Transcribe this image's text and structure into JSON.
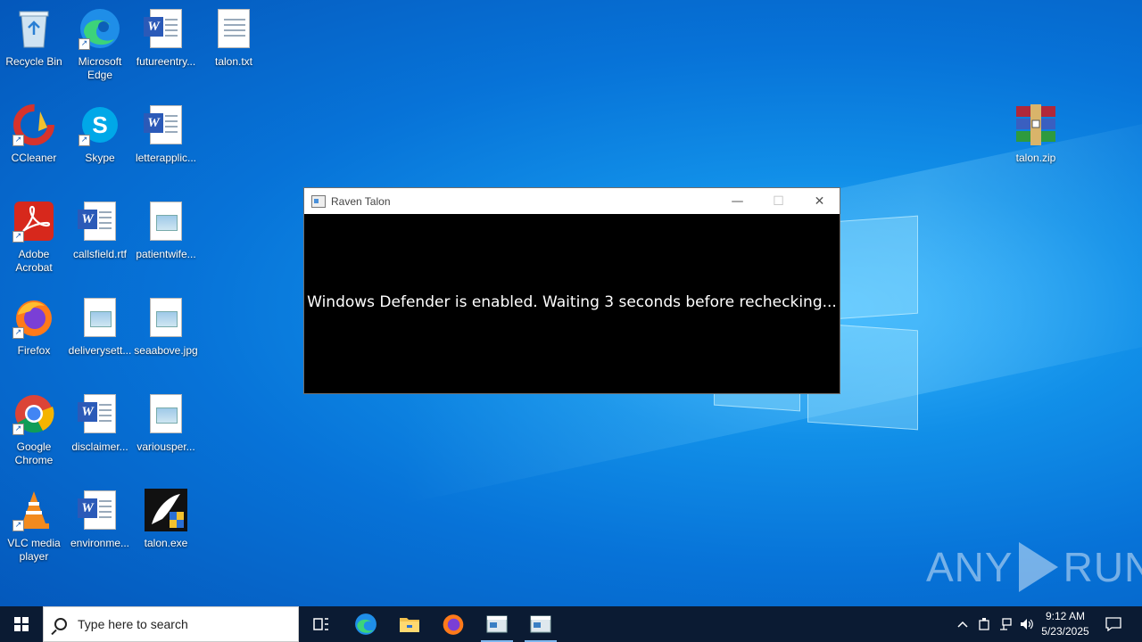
{
  "desktop": {
    "icons": [
      {
        "label": "Recycle Bin"
      },
      {
        "label": "Microsoft Edge"
      },
      {
        "label": "futureentry..."
      },
      {
        "label": "talon.txt"
      },
      {
        "label": "CCleaner"
      },
      {
        "label": "Skype"
      },
      {
        "label": "letterapplic..."
      },
      {
        "label": "Adobe Acrobat"
      },
      {
        "label": "callsfield.rtf"
      },
      {
        "label": "patientwife..."
      },
      {
        "label": "Firefox"
      },
      {
        "label": "deliverysett..."
      },
      {
        "label": "seaabove.jpg"
      },
      {
        "label": "Google Chrome"
      },
      {
        "label": "disclaimer..."
      },
      {
        "label": "variousper..."
      },
      {
        "label": "VLC media player"
      },
      {
        "label": "environme..."
      },
      {
        "label": "talon.exe"
      },
      {
        "label": "talon.zip"
      }
    ]
  },
  "window": {
    "title": "Raven Talon",
    "minimize_glyph": "—",
    "maximize_glyph": "☐",
    "close_glyph": "✕",
    "console_text": "Windows Defender is enabled. Waiting 3 seconds before rechecking..."
  },
  "watermark": {
    "left": "ANY",
    "right": "RUN"
  },
  "taskbar": {
    "search_placeholder": "Type here to search",
    "time": "9:12 AM",
    "date": "5/23/2025"
  },
  "colors": {
    "desktop_blue": "#0773d8",
    "taskbar": "#0b1b33",
    "console_bg": "#000000"
  }
}
